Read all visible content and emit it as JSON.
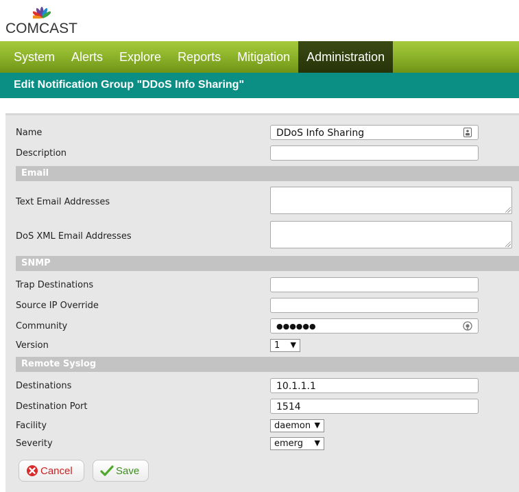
{
  "brand": {
    "name": "COMCAST"
  },
  "nav": {
    "items": [
      {
        "label": "System"
      },
      {
        "label": "Alerts"
      },
      {
        "label": "Explore"
      },
      {
        "label": "Reports"
      },
      {
        "label": "Mitigation"
      },
      {
        "label": "Administration",
        "active": true
      }
    ]
  },
  "page": {
    "title": "Edit Notification Group \"DDoS Info Sharing\""
  },
  "form": {
    "name": {
      "label": "Name",
      "value": "DDoS Info Sharing"
    },
    "description": {
      "label": "Description",
      "value": ""
    },
    "email_section": "Email",
    "text_email": {
      "label": "Text Email Addresses",
      "value": ""
    },
    "dos_xml_email": {
      "label": "DoS XML Email Addresses",
      "value": ""
    },
    "snmp_section": "SNMP",
    "trap_destinations": {
      "label": "Trap Destinations",
      "value": ""
    },
    "source_ip_override": {
      "label": "Source IP Override",
      "value": ""
    },
    "community": {
      "label": "Community",
      "value": "●●●●●●"
    },
    "version": {
      "label": "Version",
      "value": "1"
    },
    "syslog_section": "Remote Syslog",
    "destinations": {
      "label": "Destinations",
      "value": "10.1.1.1"
    },
    "destination_port": {
      "label": "Destination Port",
      "value": "1514"
    },
    "facility": {
      "label": "Facility",
      "value": "daemon"
    },
    "severity": {
      "label": "Severity",
      "value": "emerg"
    }
  },
  "buttons": {
    "cancel": "Cancel",
    "save": "Save"
  },
  "icons": {
    "cancel": "x-circle-icon",
    "save": "checkmark-icon",
    "name_field": "contact-card-icon",
    "community_field": "reveal-password-icon",
    "select_arrow": "▼"
  },
  "colors": {
    "nav": "#8fb52c",
    "nav_active": "#2f3d0e",
    "titlebar": "#0b8f85",
    "section": "#c3c3c3",
    "panel": "#e7e7e7",
    "cancel": "#cc1f1f",
    "save": "#3c8d1e"
  }
}
